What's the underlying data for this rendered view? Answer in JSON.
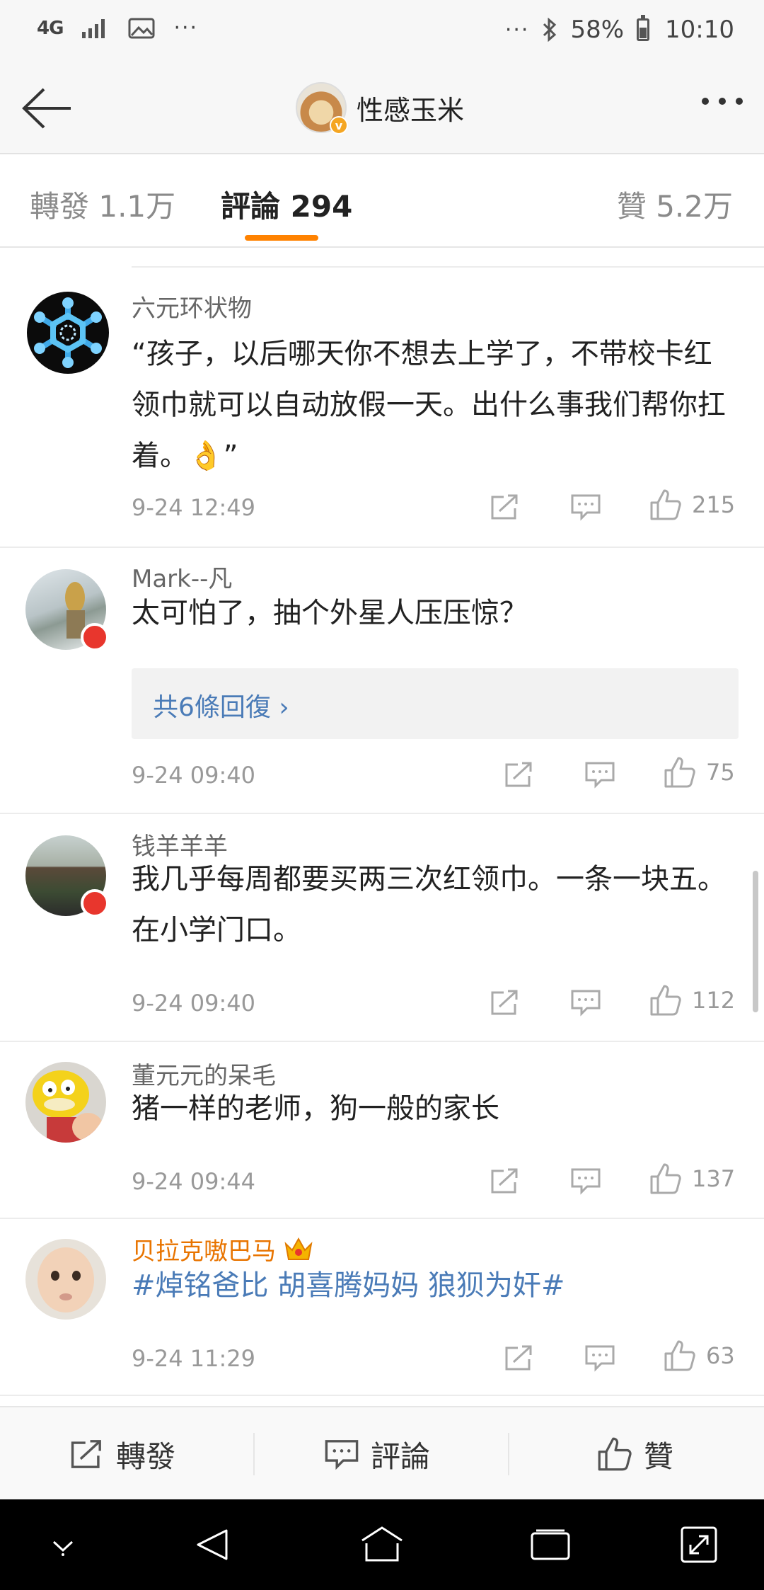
{
  "status_bar": {
    "network": "4G",
    "dots_left": "···",
    "dots_right": "···",
    "battery_percent": "58%",
    "battery_level": 0.58,
    "time": "10:10"
  },
  "header": {
    "title": "性感玉米",
    "verified_mark": "v"
  },
  "tabs": [
    {
      "label": "轉發 1.1万"
    },
    {
      "label": "評論 294"
    },
    {
      "label": "贊 5.2万"
    }
  ],
  "active_tab": "評論 294",
  "accent_color": "#ff8200",
  "comments": [
    {
      "user": "六元环状物",
      "text": "“孩子，以后哪天你不想去上学了，不带校卡红领巾就可以自动放假一天。出什么事我们帮你扛着。👌”",
      "time": "9-24 12:49",
      "likes": "215"
    },
    {
      "user": "Mark--凡",
      "text": "太可怕了，抽个外星人压压惊？",
      "replies": "共6條回復 ›",
      "time": "9-24 09:40",
      "likes": "75"
    },
    {
      "user": "钱羊羊羊",
      "text": "我几乎每周都要买两三次红领巾。一条一块五。在小学门口。",
      "time": "9-24 09:40",
      "likes": "112"
    },
    {
      "user": "董元元的呆毛",
      "text": "猪一样的老师，狗一般的家长",
      "time": "9-24 09:44",
      "likes": "137"
    },
    {
      "user": "贝拉克嗷巴马",
      "text": "#焯铭爸比 胡喜腾妈妈 狼狈为奸#",
      "time": "9-24 11:29",
      "likes": "63"
    }
  ],
  "bottom_bar": {
    "repost": "轉發",
    "comment": "評論",
    "like": "贊"
  },
  "icons": [
    "back-arrow-icon",
    "more-icon",
    "share-icon",
    "comment-icon",
    "thumbs-up-icon",
    "crown-icon",
    "bluetooth-icon",
    "signal-icon",
    "image-icon",
    "battery-icon"
  ]
}
